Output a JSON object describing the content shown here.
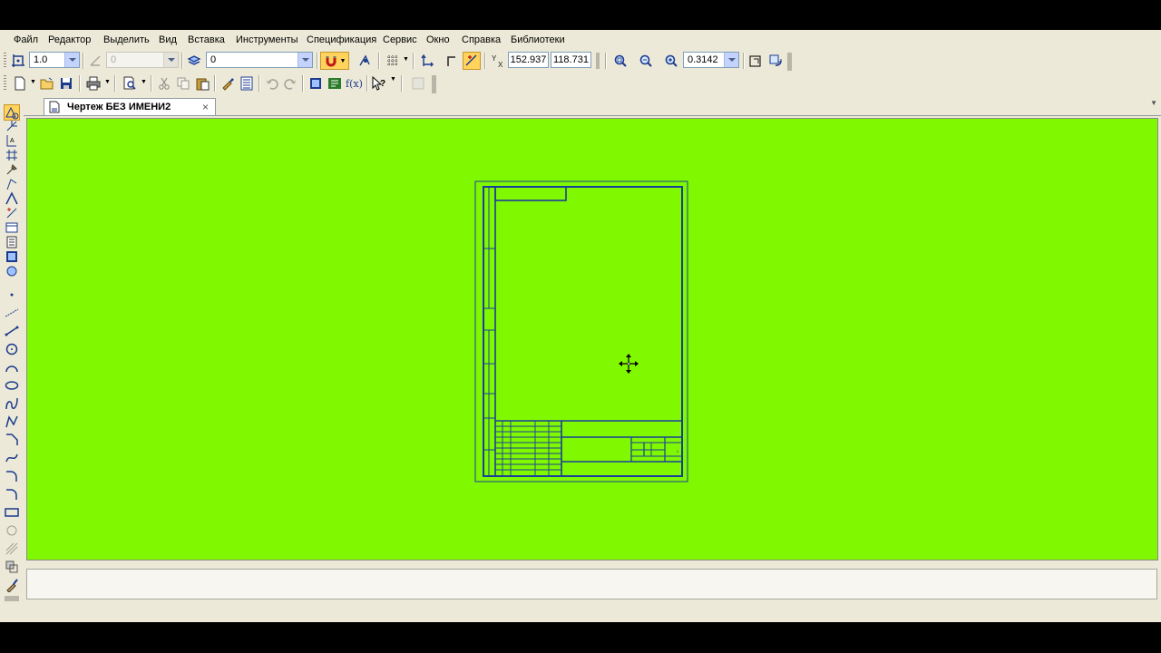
{
  "menu": [
    "Файл",
    "Редактор",
    "Выделить",
    "Вид",
    "Вставка",
    "Инструменты",
    "Спецификация",
    "Сервис",
    "Окно",
    "Справка",
    "Библиотеки"
  ],
  "toolbar": {
    "step": "1.0",
    "angle_step": "0",
    "layer": "0",
    "coord_x": "152.937",
    "coord_y": "118.731",
    "zoom": "0.3142"
  },
  "document": {
    "tab_title": "Чертеж БЕЗ ИМЕНИ2"
  },
  "colors": {
    "canvas": "#80f800",
    "frame_lines": "#1a3f9a"
  },
  "icons": {
    "cursor": "move-cursor-icon"
  }
}
